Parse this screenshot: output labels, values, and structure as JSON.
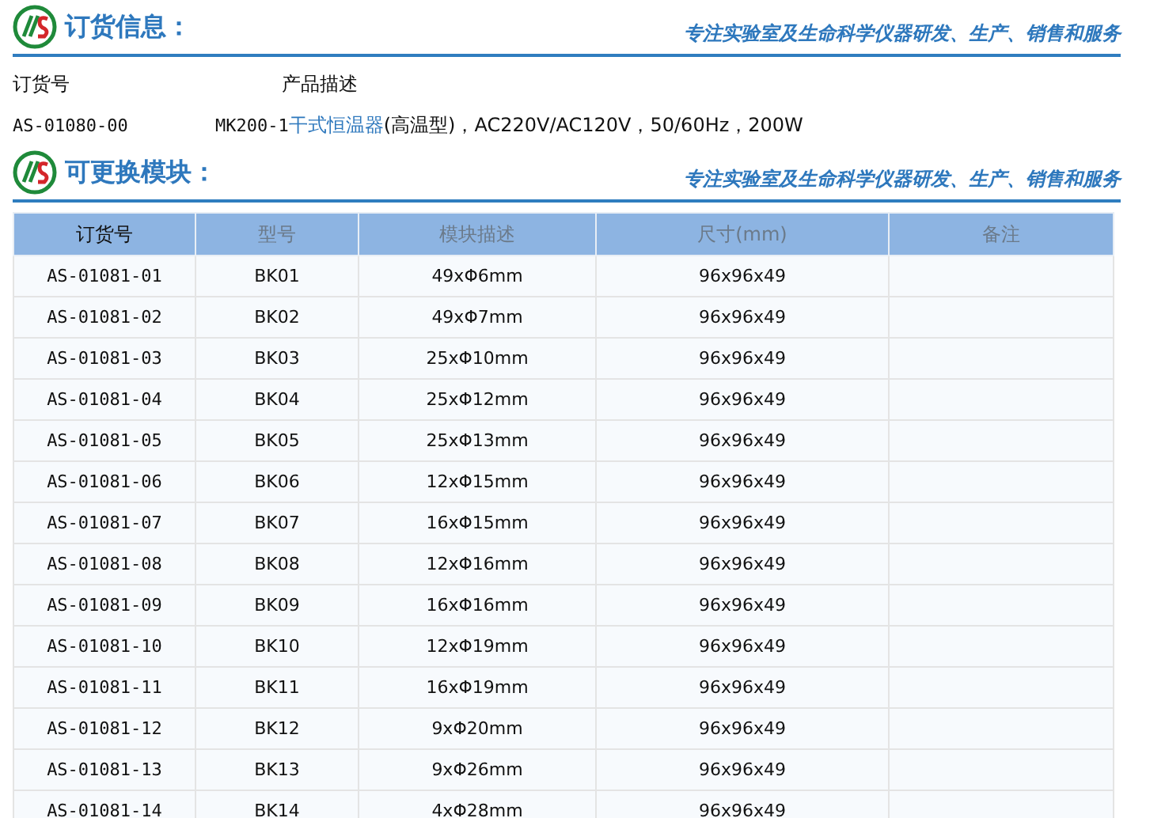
{
  "order_section": {
    "title": "订货信息：",
    "slogan": "专注实验室及生命科学仪器研发、生产、销售和服务",
    "columns": [
      "订货号",
      "产品描述"
    ],
    "row": {
      "order_no": "AS-01080-00",
      "model": "MK200-1",
      "name": "干式恒温器",
      "spec": "(高温型)，AC220V/AC120V，50/60Hz，200W"
    }
  },
  "module_section": {
    "title": "可更换模块：",
    "slogan": "专注实验室及生命科学仪器研发、生产、销售和服务",
    "table": {
      "columns": [
        "订货号",
        "型号",
        "模块描述",
        "尺寸(mm)",
        "备注"
      ],
      "rows": [
        [
          "AS-01081-01",
          "BK01",
          "49xΦ6mm",
          "96x96x49"
        ],
        [
          "AS-01081-02",
          "BK02",
          "49xΦ7mm",
          "96x96x49"
        ],
        [
          "AS-01081-03",
          "BK03",
          "25xΦ10mm",
          "96x96x49"
        ],
        [
          "AS-01081-04",
          "BK04",
          "25xΦ12mm",
          "96x96x49"
        ],
        [
          "AS-01081-05",
          "BK05",
          "25xΦ13mm",
          "96x96x49"
        ],
        [
          "AS-01081-06",
          "BK06",
          "12xΦ15mm",
          "96x96x49"
        ],
        [
          "AS-01081-07",
          "BK07",
          "16xΦ15mm",
          "96x96x49"
        ],
        [
          "AS-01081-08",
          "BK08",
          "12xΦ16mm",
          "96x96x49"
        ],
        [
          "AS-01081-09",
          "BK09",
          "16xΦ16mm",
          "96x96x49"
        ],
        [
          "AS-01081-10",
          "BK10",
          "12xΦ19mm",
          "96x96x49"
        ],
        [
          "AS-01081-11",
          "BK11",
          "16xΦ19mm",
          "96x96x49"
        ],
        [
          "AS-01081-12",
          "BK12",
          "9xΦ20mm",
          "96x96x49"
        ],
        [
          "AS-01081-13",
          "BK13",
          "9xΦ26mm",
          "96x96x49"
        ],
        [
          "AS-01081-14",
          "BK14",
          "4xΦ28mm",
          "96x96x49"
        ]
      ]
    }
  }
}
